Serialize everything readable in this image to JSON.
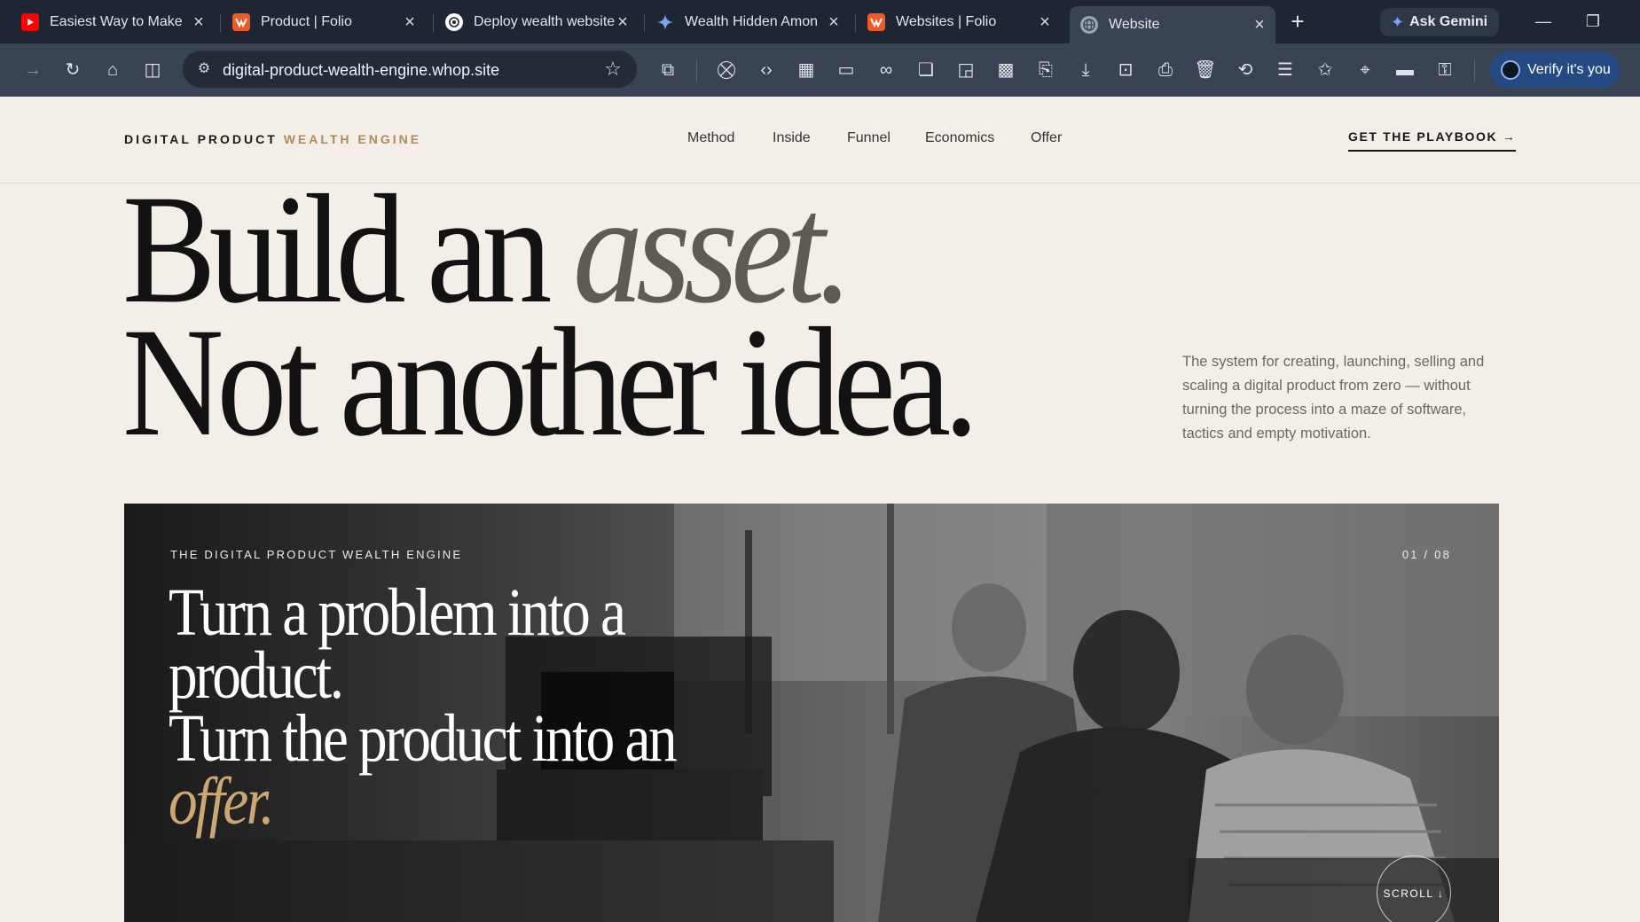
{
  "browser": {
    "tabs": [
      {
        "title": "Easiest Way to Make M",
        "icon": "youtube-icon",
        "color": "#ff0000"
      },
      {
        "title": "Product | Folio",
        "icon": "folio-icon",
        "color": "#ef5a24"
      },
      {
        "title": "Deploy wealth website",
        "icon": "openai-icon",
        "color": "#ffffff"
      },
      {
        "title": "Wealth Hidden Among",
        "icon": "gemini-sparkle-icon",
        "color": "#7aa3f5"
      },
      {
        "title": "Websites | Folio",
        "icon": "folio-icon",
        "color": "#ef5a24"
      },
      {
        "title": "Website",
        "icon": "globe-icon",
        "color": "#9aa3ad"
      }
    ],
    "ask_gemini": "Ask Gemini",
    "url": "digital-product-wealth-engine.whop.site",
    "verify": "Verify it's you"
  },
  "site": {
    "brand_primary": "DIGITAL PRODUCT",
    "brand_accent": "WEALTH ENGINE",
    "accent_color": "#b08a52",
    "nav": [
      "Method",
      "Inside",
      "Funnel",
      "Economics",
      "Offer"
    ],
    "cta": "GET THE PLAYBOOK →"
  },
  "hero": {
    "line1_a": "Build an",
    "line1_b": "asset.",
    "line2": "Not another idea.",
    "description": "The system for creating, launching, selling and scaling a digital product from zero — without turning the process into a maze of software, tactics and empty motivation."
  },
  "slide": {
    "label": "THE DIGITAL PRODUCT WEALTH ENGINE",
    "counter": "01 / 08",
    "line1": "Turn a problem into a",
    "line2": "product.",
    "line3": "Turn the product into an",
    "line4": "offer.",
    "scroll": "SCROLL ↓"
  }
}
